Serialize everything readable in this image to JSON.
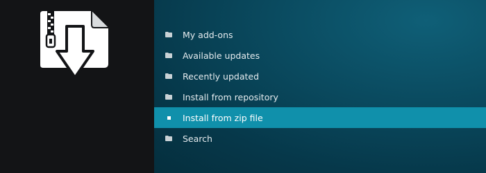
{
  "left_panel": {
    "icon": "zip-file-download-icon"
  },
  "menu": {
    "items": [
      {
        "label": "My add-ons",
        "icon": "folder-icon",
        "active": false
      },
      {
        "label": "Available updates",
        "icon": "folder-icon",
        "active": false
      },
      {
        "label": "Recently updated",
        "icon": "folder-icon",
        "active": false
      },
      {
        "label": "Install from repository",
        "icon": "folder-icon",
        "active": false
      },
      {
        "label": "Install from zip file",
        "icon": "square-bullet-icon",
        "active": true
      },
      {
        "label": "Search",
        "icon": "folder-icon",
        "active": false
      }
    ]
  },
  "colors": {
    "left_background": "#131416",
    "right_background": "#0a4a5f",
    "highlight": "#1090ab",
    "text": "#e6ecef"
  }
}
